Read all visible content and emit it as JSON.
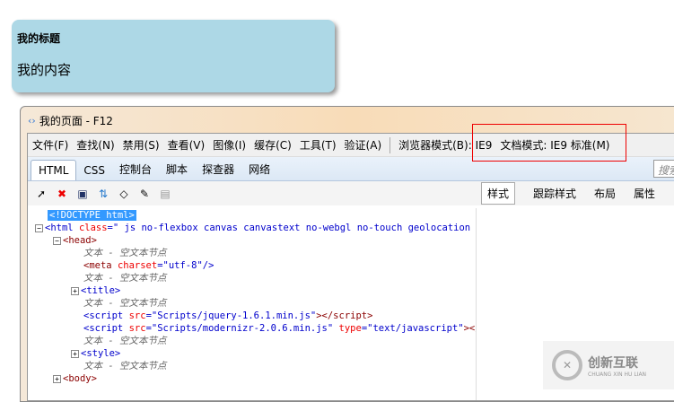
{
  "page": {
    "heading": "我的标题",
    "content": "我的内容"
  },
  "devtools": {
    "title": "我的页面 - F12",
    "menu": [
      "文件(F)",
      "查找(N)",
      "禁用(S)",
      "查看(V)",
      "图像(I)",
      "缓存(C)",
      "工具(T)",
      "验证(A)"
    ],
    "browser_mode": "浏览器模式(B): IE9",
    "document_mode": "文档模式: IE9 标准(M)",
    "tabs": [
      "HTML",
      "CSS",
      "控制台",
      "脚本",
      "探查器",
      "网络"
    ],
    "search_placeholder": "搜索",
    "right_tabs": [
      "样式",
      "跟踪样式",
      "布局",
      "属性"
    ],
    "tree": {
      "doctype": "<!DOCTYPE html>",
      "html_open": "<html",
      "class_attr": "class",
      "class_val": "=\" js no-flexbox canvas canvastext no-webgl no-touch geolocation pos",
      "head": "<head>",
      "empty_text": "文本 - 空文本节点",
      "meta": "<meta",
      "charset": "charset",
      "charset_val": "=\"utf-8\"/>",
      "title": "<title>",
      "script": "<script",
      "src": "src",
      "src1": "=\"Scripts/jquery-1.6.1.min.js\"",
      "close1": "></script>",
      "src2": "=\"Scripts/modernizr-2.0.6.min.js\"",
      "type": "type",
      "type_val": "=\"text/javascript\"",
      "close2": "></scr",
      "style": "<style>",
      "body": "<body>"
    }
  },
  "watermark": {
    "name": "创新互联",
    "pinyin": "CHUANG XIN HU LIAN"
  }
}
